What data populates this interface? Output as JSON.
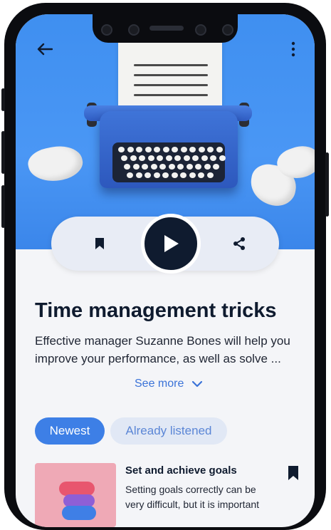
{
  "header": {
    "back_icon": "arrow-left-icon",
    "menu_icon": "more-vertical-icon"
  },
  "player": {
    "bookmark_icon": "bookmark-icon",
    "play_icon": "play-icon",
    "share_icon": "share-icon"
  },
  "episode": {
    "title": "Time management tricks",
    "description": "Effective manager Suzanne Bones will help you improve your performance, as well as solve ...",
    "see_more": "See more"
  },
  "tabs": [
    {
      "label": "Newest",
      "active": true
    },
    {
      "label": "Already listened",
      "active": false
    }
  ],
  "list": [
    {
      "title": "Set and achieve goals",
      "description": "Setting goals correctly can be very difficult, but it is important"
    }
  ],
  "colors": {
    "accent": "#3d7fe6",
    "dark": "#0f1b2f",
    "hero": "#4a97f5"
  }
}
